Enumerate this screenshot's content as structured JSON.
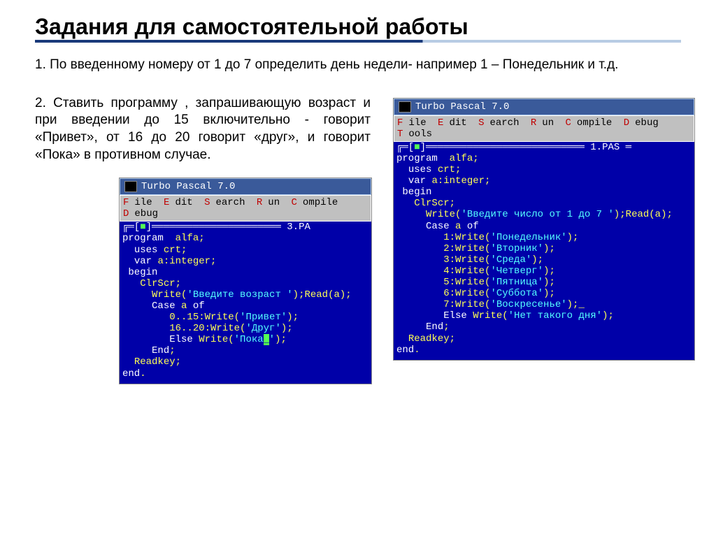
{
  "title": "Задания для самостоятельной работы",
  "task1": "1. По введенному номеру от 1 до 7 определить день недели- например 1 – Понедельник и т.д.",
  "task2": "2. Ставить программу , запрашивающую возраст и при введении до 15 включительно - говорит «Привет», от 16 до 20 говорит «друг», и говорит «Пока» в противном случае.",
  "window1": {
    "title": "Turbo Pascal 7.0",
    "menu": {
      "file": "File",
      "edit": "Edit",
      "search": "Search",
      "run": "Run",
      "compile": "Compile",
      "debug": "Debug",
      "tools": "Tools"
    },
    "filename": "1.PAS",
    "code": [
      "program  alfa;",
      "  uses crt;",
      "  var a:integer;",
      " begin",
      "   ClrScr;",
      "     Write('Введите число от 1 до 7 ');Read(a);",
      "     Case a of",
      "        1:Write('Понедельник');",
      "        2:Write('Вторник');",
      "        3:Write('Среда');",
      "        4:Write('Четверг');",
      "        5:Write('Пятница');",
      "        6:Write('Суббота');",
      "        7:Write('Воскресенье');_",
      "        Else Write('Нет такого дня');",
      "     End;",
      "  Readkey;",
      "end."
    ]
  },
  "window2": {
    "title": "Turbo Pascal 7.0",
    "menu": {
      "file": "File",
      "edit": "Edit",
      "search": "Search",
      "run": "Run",
      "compile": "Compile",
      "debug": "Debug"
    },
    "filename": "3.PA",
    "code": [
      "program  alfa;",
      "  uses crt;",
      "  var a:integer;",
      " begin",
      "   ClrScr;",
      "     Write('Введите возраст ');Read(a);",
      "     Case a of",
      "        0..15:Write('Привет');",
      "        16..20:Write('Друг');",
      "        Else Write('Пока_');",
      "     End;",
      "  Readkey;",
      "end."
    ]
  }
}
